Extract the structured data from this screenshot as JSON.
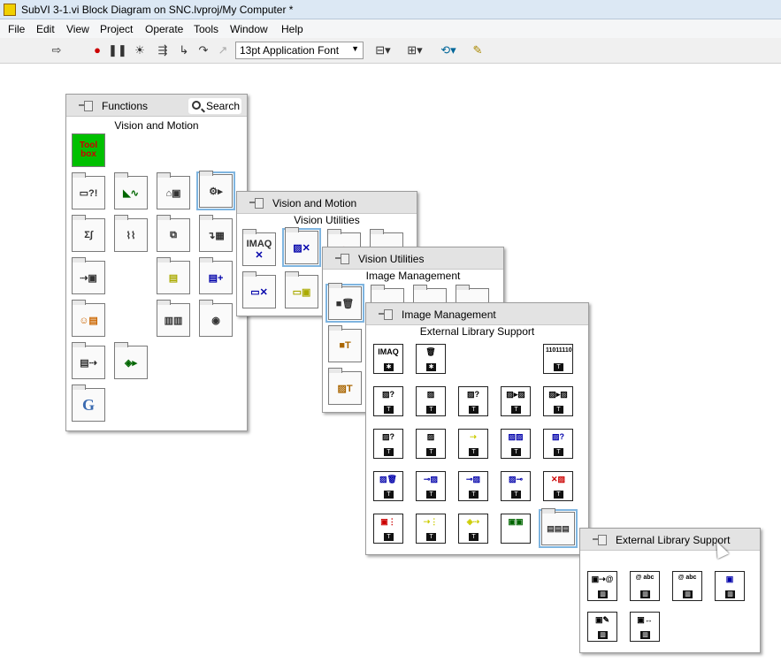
{
  "window": {
    "title": "SubVI 3-1.vi Block Diagram on SNC.lvproj/My Computer *"
  },
  "menu": [
    "File",
    "Edit",
    "View",
    "Project",
    "Operate",
    "Tools",
    "Window",
    "Help"
  ],
  "toolbar": {
    "font_value": "13pt Application Font"
  },
  "functions_palette": {
    "title": "Functions",
    "search_label": "Search",
    "subtitle": "Vision and Motion",
    "toolbox_label_1": "Tool",
    "toolbox_label_2": "box"
  },
  "vision_motion_palette": {
    "title": "Vision and Motion",
    "subtitle": "Vision Utilities",
    "imaq_label": "IMAQ"
  },
  "vision_utilities_palette": {
    "title": "Vision Utilities",
    "subtitle": "Image Management"
  },
  "image_management_palette": {
    "title": "Image Management",
    "subtitle": "External Library Support",
    "imaq_label": "IMAQ",
    "binary_label": "11011110"
  },
  "external_library_palette": {
    "title": "External Library Support"
  },
  "colors": {
    "selection": "#7fb5e0",
    "header": "#e3e3e3",
    "titlebar": "#dce8f4"
  }
}
